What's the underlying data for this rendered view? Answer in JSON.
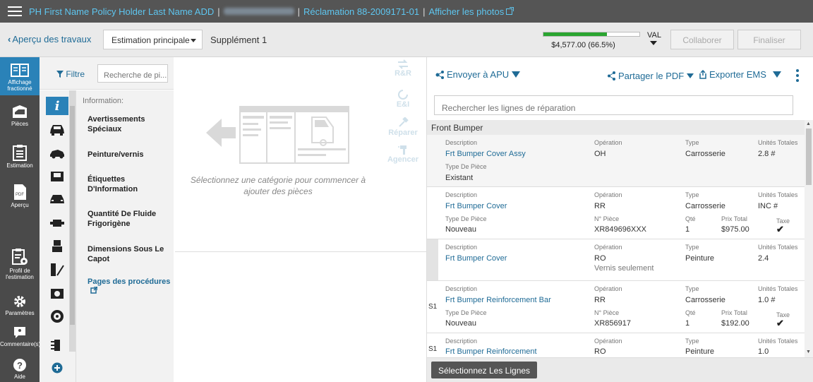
{
  "topbar": {
    "policy_holder": "PH First Name Policy Holder Last Name ADD",
    "claim": "Réclamation 88-2009171-01",
    "photos": "Afficher les photos",
    "separator": "|"
  },
  "subbar": {
    "back_label": "Aperçu des travaux",
    "estimate_select": "Estimation principale",
    "supplement": "Supplément 1",
    "total": "$4,577.00 (66.5%)",
    "progress_fraction": 0.665,
    "val_label": "VAL",
    "collaborate": "Collaborer",
    "finalize": "Finaliser"
  },
  "leftnav": {
    "items": [
      {
        "label": "Affichage fractionné",
        "icon": "split-view-icon"
      },
      {
        "label": "Pièces",
        "icon": "parts-icon"
      },
      {
        "label": "Estimation",
        "icon": "estimate-clipboard-icon"
      },
      {
        "label": "Aperçu",
        "icon": "pdf-preview-icon"
      },
      {
        "label": "Profil de l'estimation",
        "icon": "estimate-profile-icon"
      },
      {
        "label": "Paramètres",
        "icon": "gear-icon"
      },
      {
        "label": "Commentaire(s)",
        "icon": "comment-icon"
      },
      {
        "label": "Aide",
        "icon": "help-icon"
      }
    ]
  },
  "filter": {
    "label": "Filtre",
    "search_placeholder": "Recherche de pi..."
  },
  "info": {
    "heading": "Information:",
    "items": [
      "Avertissements Spéciaux",
      "Peinture/vernis",
      "Étiquettes D'Information",
      "Quantité De Fluide Frigorigène",
      "Dimensions Sous Le Capot",
      "Pages des procédures"
    ]
  },
  "middle": {
    "message": "Sélectionnez une catégorie pour commencer à ajouter des pièces",
    "actions": [
      "R&R",
      "E&I",
      "Réparer",
      "Agencer"
    ]
  },
  "right": {
    "send_apu": "Envoyer à APU",
    "share_pdf": "Partager le PDF",
    "export_ems": "Exporter EMS",
    "search_placeholder": "Rechercher les lignes de réparation",
    "group": "Front Bumper",
    "labels": {
      "description": "Description",
      "operation": "Opération",
      "type": "Type",
      "units": "Unités Totales",
      "part_type": "Type De Pièce",
      "part_no": "N° Pièce",
      "qty": "Qté",
      "total_price": "Prix Total",
      "tax": "Taxe"
    },
    "lines": [
      {
        "desc": "Frt Bumper Cover Assy",
        "op": "OH",
        "type": "Carrosserie",
        "units": "2.8 #",
        "part_type": "Existant"
      },
      {
        "desc": "Frt Bumper Cover",
        "op": "RR",
        "type": "Carrosserie",
        "units": "INC #",
        "part_type": "Nouveau",
        "part_no": "XR849696XXX",
        "qty": "1",
        "price": "$975.00"
      },
      {
        "desc": "Frt Bumper Cover",
        "op": "RO",
        "op_note": "Vernis seulement",
        "type": "Peinture",
        "units": "2.4"
      },
      {
        "segment": "S1",
        "desc": "Frt Bumper Reinforcement Bar",
        "op": "RR",
        "type": "Carrosserie",
        "units": "1.0 #",
        "part_type": "Nouveau",
        "part_no": "XR856917",
        "qty": "1",
        "price": "$192.00"
      },
      {
        "segment": "S1",
        "desc": "Frt Bumper Reinforcement",
        "op": "RO",
        "type": "Peinture",
        "units": "1.0"
      }
    ],
    "select_lines": "Sélectionnez Les Lignes"
  },
  "colors": {
    "topbar": "#555555",
    "link": "#1f6b96",
    "accent": "#2a82b8",
    "progress": "#2aa530"
  }
}
